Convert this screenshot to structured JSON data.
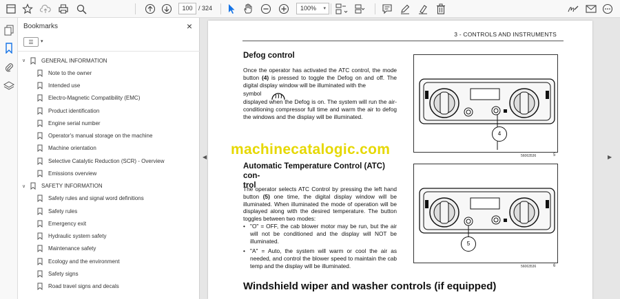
{
  "toolbar": {
    "page_current": "100",
    "page_total": "/ 324",
    "zoom": "100%",
    "zoom_caret": "▾"
  },
  "bookmarks": {
    "title": "Bookmarks",
    "close": "×",
    "options_icon": "☰",
    "options_caret": "▾",
    "items": [
      {
        "label": "GENERAL INFORMATION",
        "level": 0,
        "expanded": true
      },
      {
        "label": "Note to the owner",
        "level": 1
      },
      {
        "label": "Intended use",
        "level": 1
      },
      {
        "label": "Electro-Magnetic Compatibility (EMC)",
        "level": 1
      },
      {
        "label": "Product identification",
        "level": 1
      },
      {
        "label": "Engine serial number",
        "level": 1
      },
      {
        "label": "Operator's manual storage on the machine",
        "level": 1
      },
      {
        "label": "Machine orientation",
        "level": 1
      },
      {
        "label": "Selective Catalytic Reduction (SCR) - Overview",
        "level": 1
      },
      {
        "label": "Emissions overview",
        "level": 1
      },
      {
        "label": "SAFETY INFORMATION",
        "level": 0,
        "expanded": true
      },
      {
        "label": "Safety rules and signal word definitions",
        "level": 1
      },
      {
        "label": "Safety rules",
        "level": 1
      },
      {
        "label": "Emergency exit",
        "level": 1
      },
      {
        "label": "Hydraulic system safety",
        "level": 1
      },
      {
        "label": "Maintenance safety",
        "level": 1
      },
      {
        "label": "Ecology and the environment",
        "level": 1
      },
      {
        "label": "Safety signs",
        "level": 1
      },
      {
        "label": "Road travel signs and decals",
        "level": 1
      }
    ]
  },
  "document": {
    "running_head": "3 - CONTROLS AND INSTRUMENTS",
    "defog_title": "Defog control",
    "defog_p1_a": "Once the operator has activated the ATC control, the mode button ",
    "defog_p1_b": "(4)",
    "defog_p1_c": " is pressed to toggle the Defog on and off. The digital display window will be illuminated with the",
    "defog_p2_a": "symbol",
    "defog_p2_b": "displayed when the Defog is on. The system will run the air-conditioning compressor full time and warm the air to defog the windows and the display will be illuminated.",
    "watermark": "machinecatalogic.com",
    "atc_title_1": "Automatic Temperature Control (ATC) con-",
    "atc_title_2": "trol",
    "atc_p1_a": "The operator selects ATC Control by pressing the left hand button ",
    "atc_p1_b": "(5)",
    "atc_p1_c": " one time, the digital display window will be illuminated. When illuminated the mode of operation will be displayed along with the desired temperature. The button toggles between two modes:",
    "bullet_1": "\"O\" = OFF, the cab blower motor may be run, but the air will not be conditioned and the display will NOT be illuminated.",
    "bullet_2": "\"A\" = Auto, the system will warm or cool the air as needed, and control the blower speed to maintain the cab temp and the display will be illuminated.",
    "bullet_dot": "•",
    "windshield_title": "Windshield wiper and washer controls (if equipped)",
    "fig1_callout": "4",
    "fig1_caption": "56063536",
    "fig1_number": "5",
    "fig2_callout": "5",
    "fig2_caption": "56063536",
    "fig2_number": "6"
  }
}
